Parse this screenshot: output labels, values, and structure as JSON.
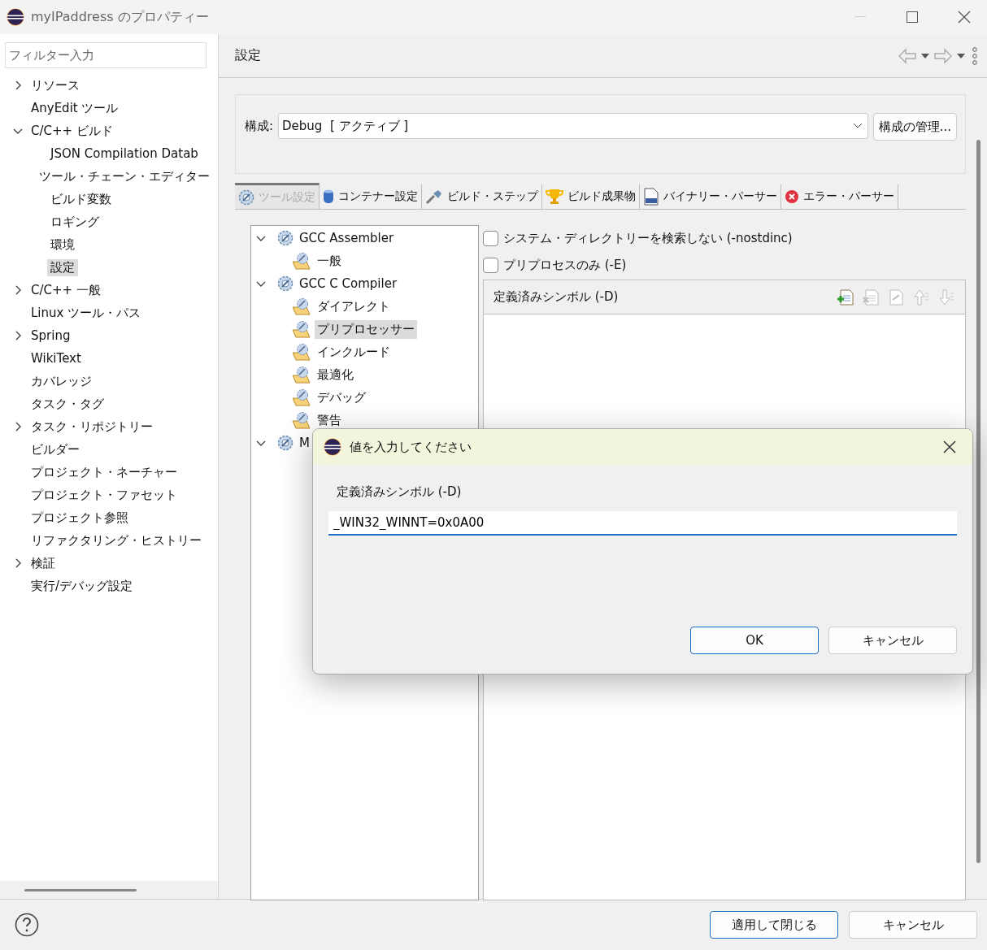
{
  "window": {
    "title": "myIPaddress のプロパティー"
  },
  "filter": {
    "placeholder": "フィルター入力"
  },
  "nav_tree": [
    {
      "label": "リソース",
      "expanded": false,
      "selected": false
    },
    {
      "label": "AnyEdit ツール",
      "selected": false
    },
    {
      "label": "C/C++ ビルド",
      "expanded": true,
      "selected": false,
      "children": [
        {
          "label": "JSON Compilation Datab",
          "selected": false
        },
        {
          "label": "ツール・チェーン・エディター",
          "selected": false
        },
        {
          "label": "ビルド変数",
          "selected": false
        },
        {
          "label": "ロギング",
          "selected": false
        },
        {
          "label": "環境",
          "selected": false
        },
        {
          "label": "設定",
          "selected": true
        }
      ]
    },
    {
      "label": "C/C++ 一般",
      "expanded": false,
      "selected": false
    },
    {
      "label": "Linux ツール・パス",
      "selected": false
    },
    {
      "label": "Spring",
      "expanded": false,
      "selected": false
    },
    {
      "label": "WikiText",
      "selected": false
    },
    {
      "label": "カバレッジ",
      "selected": false
    },
    {
      "label": "タスク・タグ",
      "selected": false
    },
    {
      "label": "タスク・リポジトリー",
      "expanded": false,
      "selected": false
    },
    {
      "label": "ビルダー",
      "selected": false
    },
    {
      "label": "プロジェクト・ネーチャー",
      "selected": false
    },
    {
      "label": "プロジェクト・ファセット",
      "selected": false
    },
    {
      "label": "プロジェクト参照",
      "selected": false
    },
    {
      "label": "リファクタリング・ヒストリー",
      "selected": false
    },
    {
      "label": "検証",
      "expanded": false,
      "selected": false
    },
    {
      "label": "実行/デバッグ設定",
      "selected": false
    }
  ],
  "page": {
    "title": "設定"
  },
  "configuration": {
    "label": "構成:",
    "value": "Debug  [ アクティブ ]",
    "manage_button": "構成の管理..."
  },
  "tabs": [
    {
      "label": "ツール設定",
      "kind": "gear",
      "selected": true
    },
    {
      "label": "コンテナー設定",
      "kind": "cylinder",
      "selected": false
    },
    {
      "label": "ビルド・ステップ",
      "kind": "brush",
      "selected": false
    },
    {
      "label": "ビルド成果物",
      "kind": "trophy",
      "selected": false
    },
    {
      "label": "バイナリー・パーサー",
      "kind": "binary",
      "selected": false
    },
    {
      "label": "エラー・パーサー",
      "kind": "error",
      "selected": false
    }
  ],
  "tool_tree": [
    {
      "label": "GCC Assembler",
      "expanded": true,
      "selected": false,
      "children": [
        {
          "label": "一般",
          "selected": false
        }
      ]
    },
    {
      "label": "GCC C Compiler",
      "expanded": true,
      "selected": false,
      "children": [
        {
          "label": "ダイアレクト",
          "selected": false
        },
        {
          "label": "プリプロセッサー",
          "selected": true
        },
        {
          "label": "インクルード",
          "selected": false
        },
        {
          "label": "最適化",
          "selected": false
        },
        {
          "label": "デバッグ",
          "selected": false
        },
        {
          "label": "警告",
          "selected": false
        }
      ]
    },
    {
      "label": "M",
      "expanded": true,
      "selected": false
    }
  ],
  "options": [
    {
      "label": "システム・ディレクトリーを検索しない (-nostdinc)",
      "checked": false
    },
    {
      "label": "プリプロセスのみ (-E)",
      "checked": false
    }
  ],
  "symbols_panel": {
    "title": "定義済みシンボル (-D)"
  },
  "dialog": {
    "title": "値を入力してください",
    "label": "定義済みシンボル (-D)",
    "value": "_WIN32_WINNT=0x0A00",
    "buttons": [
      {
        "label": "OK",
        "default": true
      },
      {
        "label": "キャンセル",
        "default": false
      }
    ]
  },
  "footer_buttons": [
    {
      "label": "適用して閉じる",
      "default": true
    },
    {
      "label": "キャンセル",
      "default": false
    }
  ]
}
